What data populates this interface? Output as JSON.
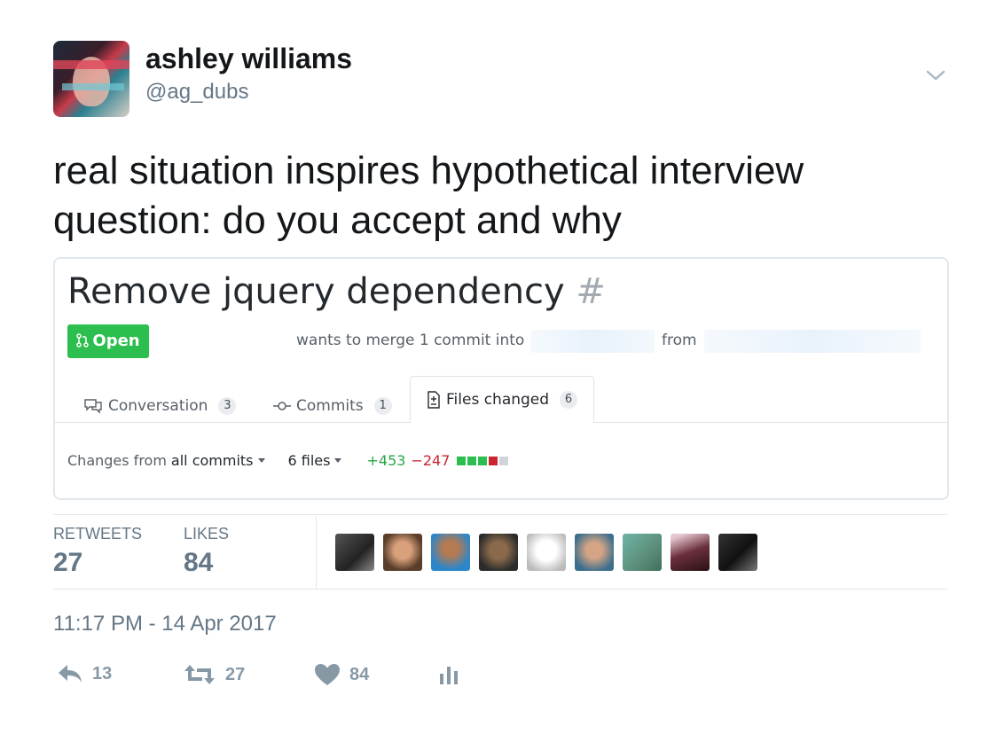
{
  "author": {
    "name": "ashley williams",
    "handle": "@ag_dubs",
    "avatar_icon": "avatar-glitch-photo"
  },
  "tweet": {
    "text": "real situation inspires hypothetical interview question: do you accept and why"
  },
  "embedded_screenshot": {
    "pr_title": "Remove jquery dependency",
    "pr_number_prefix": "#",
    "status_label": "Open",
    "merge_text": "wants to merge 1 commit into",
    "from_text": "from",
    "tabs": [
      {
        "label": "Conversation",
        "count": "3",
        "icon": "comment-discussion-icon"
      },
      {
        "label": "Commits",
        "count": "1",
        "icon": "commit-icon"
      },
      {
        "label": "Files changed",
        "count": "6",
        "icon": "file-diff-icon"
      }
    ],
    "changes_from_label": "Changes from",
    "changes_from_value": "all commits",
    "files_label": "6 files",
    "additions": "+453",
    "deletions": "−247",
    "diffstat_colors": [
      "#2cbe4e",
      "#2cbe4e",
      "#2cbe4e",
      "#cb2431",
      "#d1d5da"
    ]
  },
  "stats": {
    "retweets_label": "RETWEETS",
    "retweets_value": "27",
    "likes_label": "LIKES",
    "likes_value": "84",
    "liker_avatar_count": 9
  },
  "timestamp": "11:17 PM - 14 Apr 2017",
  "actions": {
    "reply_count": "13",
    "retweet_count": "27",
    "like_count": "84"
  },
  "colors": {
    "text_primary": "#14171a",
    "text_secondary": "#657786",
    "action_gray": "#8899a6",
    "github_green": "#2cbe4e"
  }
}
